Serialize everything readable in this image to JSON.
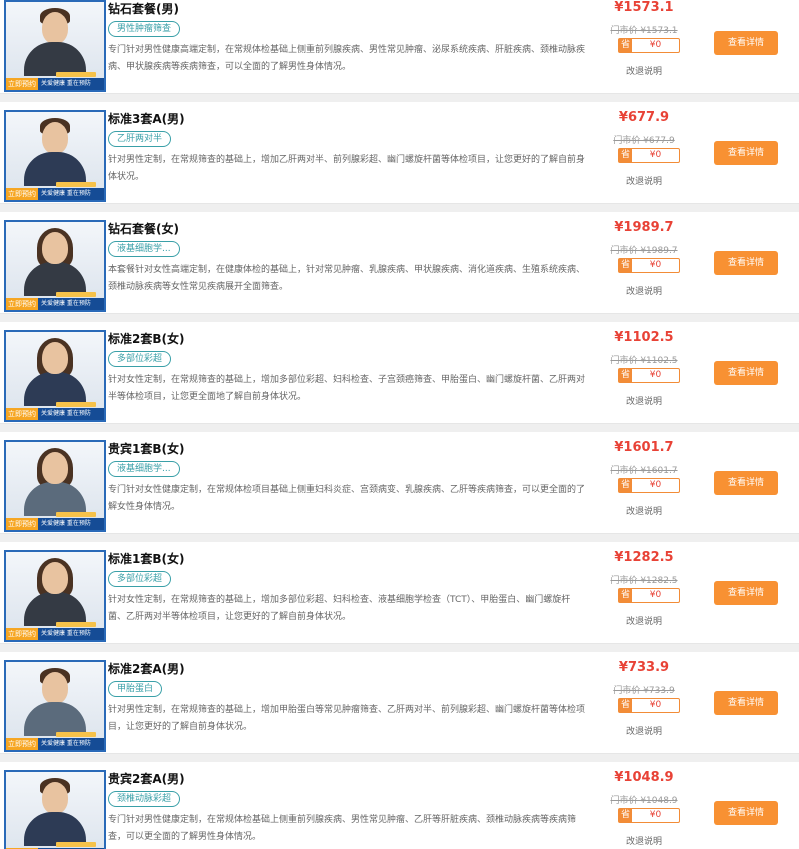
{
  "ui": {
    "brand_logo": "立即预约",
    "brand_slogan": "关爱健康  重在预防",
    "save_label": "省",
    "detail_button_label": "查看详情",
    "refund_label": "改退说明",
    "original_price_prefix": "门市价 "
  },
  "packages": [
    {
      "title": "钻石套餐(男)",
      "tag": "男性肿瘤筛查",
      "desc": "专门针对男性健康高端定制，在常规体检基础上侧重前列腺疾病、男性常见肿瘤、泌尿系统疾病、肝脏疾病、颈椎动脉疾病、甲状腺疾病等疾病筛查，可以全面的了解男性身体情况。",
      "price": "¥1573.1",
      "original_price": "门市价 ¥1573.1",
      "save_value": "¥0",
      "gender": "male"
    },
    {
      "title": "标准3套A(男)",
      "tag": "乙肝两对半",
      "desc": "针对男性定制，在常规筛查的基础上，增加乙肝两对半、前列腺彩超、幽门螺旋杆菌等体检项目，让您更好的了解自前身体状况。",
      "price": "¥677.9",
      "original_price": "门市价 ¥677.9",
      "save_value": "¥0",
      "gender": "male"
    },
    {
      "title": "钻石套餐(女)",
      "tag": "液基细胞学...",
      "desc": "本套餐针对女性高端定制，在健康体检的基础上，针对常见肿瘤、乳腺疾病、甲状腺疾病、消化道疾病、生殖系统疾病、颈椎动脉疾病等女性常见疾病展开全面筛查。",
      "price": "¥1989.7",
      "original_price": "门市价 ¥1989.7",
      "save_value": "¥0",
      "gender": "female"
    },
    {
      "title": "标准2套B(女)",
      "tag": "多部位彩超",
      "desc": "针对女性定制，在常规筛查的基础上，增加多部位彩超、妇科检查、子宫颈癌筛查、甲胎蛋白、幽门螺旋杆菌、乙肝两对半等体检项目，让您更全面地了解自前身体状况。",
      "price": "¥1102.5",
      "original_price": "门市价 ¥1102.5",
      "save_value": "¥0",
      "gender": "female"
    },
    {
      "title": "贵宾1套B(女)",
      "tag": "液基细胞学...",
      "desc": "专门针对女性健康定制，在常规体检项目基础上侧重妇科炎症、宫颈病变、乳腺疾病、乙肝等疾病筛查，可以更全面的了解女性身体情况。",
      "price": "¥1601.7",
      "original_price": "门市价 ¥1601.7",
      "save_value": "¥0",
      "gender": "female"
    },
    {
      "title": "标准1套B(女)",
      "tag": "多部位彩超",
      "desc": "针对女性定制，在常规筛查的基础上，增加多部位彩超、妇科检查、液基细胞学检查（TCT）、甲胎蛋白、幽门螺旋杆菌、乙肝两对半等体检项目，让您更好的了解自前身体状况。",
      "price": "¥1282.5",
      "original_price": "门市价 ¥1282.5",
      "save_value": "¥0",
      "gender": "female"
    },
    {
      "title": "标准2套A(男)",
      "tag": "甲胎蛋白",
      "desc": "针对男性定制，在常规筛查的基础上，增加甲胎蛋白等常见肿瘤筛查、乙肝两对半、前列腺彩超、幽门螺旋杆菌等体检项目，让您更好的了解自前身体状况。",
      "price": "¥733.9",
      "original_price": "门市价 ¥733.9",
      "save_value": "¥0",
      "gender": "male"
    },
    {
      "title": "贵宾2套A(男)",
      "tag": "颈椎动脉彩超",
      "desc": "专门针对男性健康定制，在常规体检基础上侧重前列腺疾病、男性常见肿瘤、乙肝等肝脏疾病、颈椎动脉疾病等疾病筛查，可以更全面的了解男性身体情况。",
      "price": "¥1048.9",
      "original_price": "门市价 ¥1048.9",
      "save_value": "¥0",
      "gender": "male"
    }
  ]
}
